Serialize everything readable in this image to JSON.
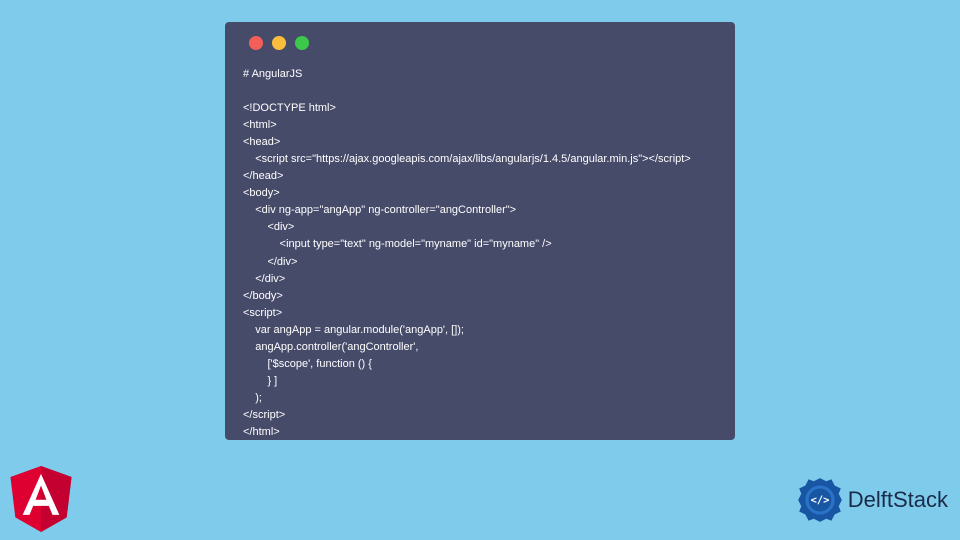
{
  "code": {
    "title": "# AngularJS",
    "lines": [
      "<!DOCTYPE html>",
      "<html>",
      "<head>",
      "    <script src=\"https://ajax.googleapis.com/ajax/libs/angularjs/1.4.5/angular.min.js\"></script>",
      "</head>",
      "<body>",
      "    <div ng-app=\"angApp\" ng-controller=\"angController\">",
      "        <div>",
      "            <input type=\"text\" ng-model=\"myname\" id=\"myname\" />",
      "        </div>",
      "    </div>",
      "</body>",
      "<script>",
      "    var angApp = angular.module('angApp', []);",
      "    angApp.controller('angController',",
      "        ['$scope', function () {",
      "        } ]",
      "    );",
      "</script>",
      "</html>"
    ]
  },
  "branding": {
    "delft_label": "DelftStack",
    "angular_letter": "A"
  },
  "window_controls": {
    "close": "close",
    "minimize": "minimize",
    "maximize": "maximize"
  }
}
